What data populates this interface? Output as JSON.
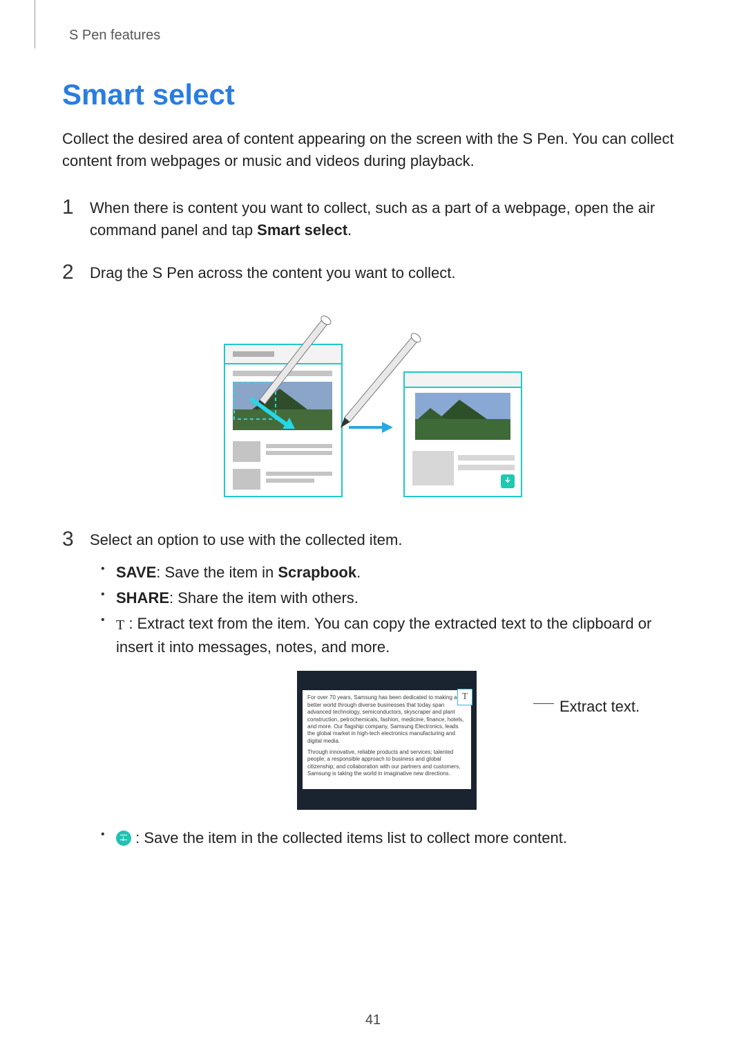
{
  "header": {
    "section": "S Pen features"
  },
  "title": "Smart select",
  "intro": "Collect the desired area of content appearing on the screen with the S Pen. You can collect content from webpages or music and videos during playback.",
  "steps": {
    "s1": {
      "num": "1",
      "pre": "When there is content you want to collect, such as a part of a webpage, open the air command panel and tap ",
      "bold": "Smart select",
      "post": "."
    },
    "s2": {
      "num": "2",
      "text": "Drag the S Pen across the content you want to collect."
    },
    "s3": {
      "num": "3",
      "text": "Select an option to use with the collected item."
    }
  },
  "options": {
    "save": {
      "label": "SAVE",
      "mid": ": Save the item in ",
      "bold": "Scrapbook",
      "post": "."
    },
    "share": {
      "label": "SHARE",
      "post": ": Share the item with others."
    },
    "extract": {
      "text": " : Extract text from the item. You can copy the extracted text to the clipboard or insert it into messages, notes, and more."
    },
    "collect": {
      "text": " : Save the item in the collected items list to collect more content."
    }
  },
  "shot": {
    "p1": "For over 70 years, Samsung has been dedicated to making a better world through diverse businesses that today span advanced technology, semiconductors, skyscraper and plant construction, petrochemicals, fashion, medicine, finance, hotels, and more. Our flagship company, Samsung Electronics, leads the global market in high-tech electronics manufacturing and digital media.",
    "p2": "Through innovative, reliable products and services; talented people; a responsible approach to business and global citizenship; and collaboration with our partners and customers, Samsung is taking the world in imaginative new directions.",
    "t": "T"
  },
  "callout": "Extract text.",
  "pagenum": "41"
}
